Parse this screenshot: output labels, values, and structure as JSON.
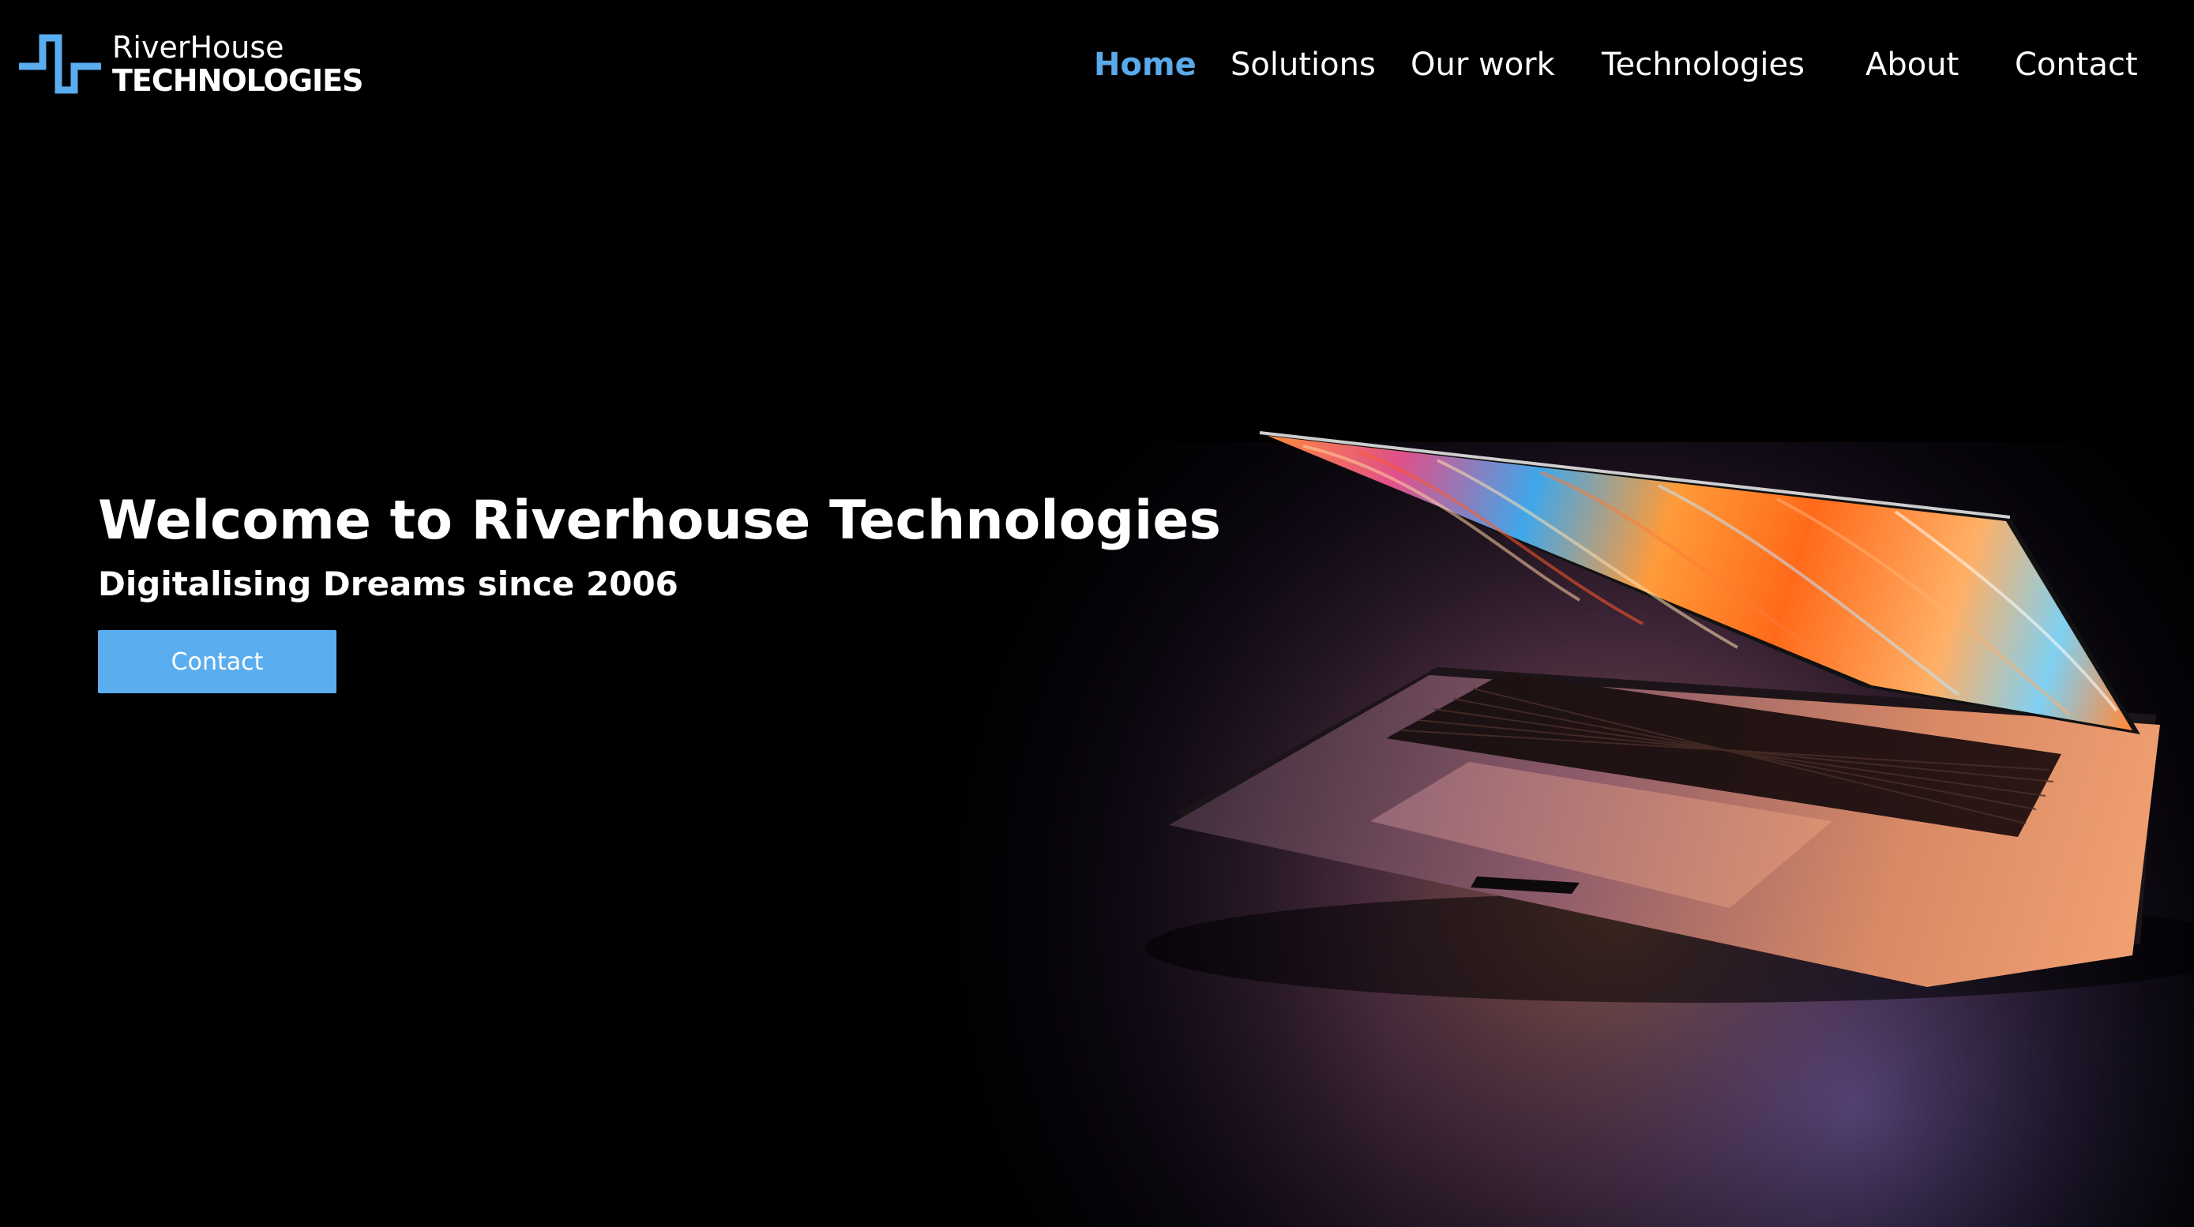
{
  "brand": {
    "name_line1": "RiverHouse",
    "name_line2": "TECHNOLOGIES",
    "logo_icon": "riverhouse-logo-icon",
    "accent_color": "#5aa9ea"
  },
  "nav": {
    "items": [
      {
        "label": "Home",
        "active": true
      },
      {
        "label": "Solutions",
        "active": false
      },
      {
        "label": "Our work",
        "active": false
      },
      {
        "label": "Technologies",
        "active": false
      },
      {
        "label": "About",
        "active": false
      },
      {
        "label": "Contact",
        "active": false
      }
    ],
    "active_color": "#5aa9ea"
  },
  "hero": {
    "title": "Welcome to Riverhouse Technologies",
    "subtitle": "Digitalising Dreams since 2006",
    "button_label": "Contact",
    "button_color": "#5aadef",
    "background_color": "#000000",
    "image": "laptop-photo"
  }
}
